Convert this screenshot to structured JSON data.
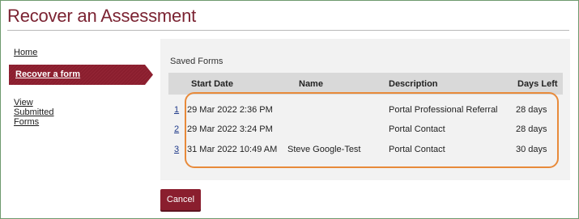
{
  "page": {
    "title": "Recover an Assessment"
  },
  "sidebar": {
    "items": [
      {
        "label": "Home",
        "active": false
      },
      {
        "label": "Recover a form",
        "active": true
      },
      {
        "label": "View Submitted Forms",
        "active": false
      }
    ]
  },
  "panel": {
    "header": "Saved Forms",
    "columns": [
      "Start Date",
      "Name",
      "Description",
      "Days Left"
    ],
    "rows": [
      {
        "index": "1",
        "start_date": "29 Mar 2022 2:36 PM",
        "name": "",
        "description": "Portal Professional Referral",
        "days_left": "28 days"
      },
      {
        "index": "2",
        "start_date": "29 Mar 2022 3:24 PM",
        "name": "",
        "description": "Portal Contact",
        "days_left": "28 days"
      },
      {
        "index": "3",
        "start_date": "31 Mar 2022 10:49 AM",
        "name": "Steve Google-Test",
        "description": "Portal Contact",
        "days_left": "30 days"
      }
    ]
  },
  "actions": {
    "cancel_label": "Cancel"
  },
  "colors": {
    "brand": "#7b2332",
    "active_nav": "#8a1e2e",
    "highlight": "#e88a3a"
  }
}
